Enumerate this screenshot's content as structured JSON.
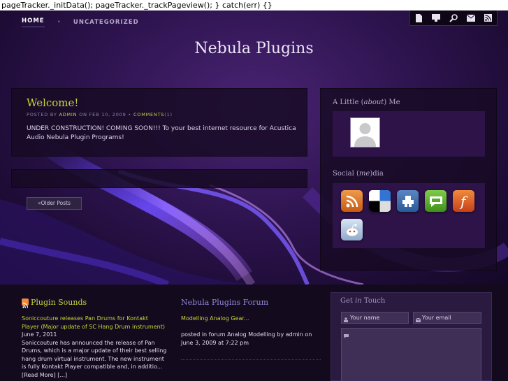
{
  "script_leak": "pageTracker._initData(); pageTracker._trackPageview(); } catch(err) {}",
  "nav": {
    "home": "HOME",
    "separator": "•",
    "uncategorized": "UNCATEGORIZED"
  },
  "toolbar_icons": [
    "document-icon",
    "monitor-icon",
    "search-icon",
    "mail-icon",
    "rss-icon"
  ],
  "site_title": "Nebula Plugins",
  "post": {
    "title": "Welcome!",
    "meta_prefix": "POSTED BY",
    "author": "ADMIN",
    "meta_on": "ON FEB 10, 2009 •",
    "comments_label": "COMMENTS",
    "comments_count": "(1)",
    "body": "UNDER CONSTRUCTION! COMING SOON!!! To your best internet resource for Acustica Audio Nebula Plugin Programs!"
  },
  "older_posts": "«Older Posts",
  "sidebar": {
    "about": {
      "a": "A Little (",
      "em": "about",
      "b": ") Me"
    },
    "social": {
      "a": "Social (",
      "em": "me",
      "b": ")dia"
    },
    "social_icons": [
      "rss-feed-icon",
      "delicious-icon",
      "stumbleupon-icon",
      "technorati-icon",
      "facebook-icon",
      "reddit-icon"
    ]
  },
  "footer": {
    "sounds_title": "Plugin Sounds",
    "sounds_link": "Soniccouture releases Pan Drums for Kontakt Player (Major update of SC Hang Drum instrument)",
    "sounds_date": " June 7, 2011",
    "sounds_body": "Soniccouture has announced the release of Pan Drums, which is a major update of their best selling hang drum virtual instrument. The new instrument is fully Kontakt Player compatible and, in additio... [Read More] [...]",
    "forum_title": "Nebula Plugins Forum",
    "forum_link": "Modelling Analog Gear...",
    "forum_body": "posted in forum Analog Modelling  by admin on June 3, 2009 at 7:22 pm",
    "touch": {
      "a": "Get ",
      "em": "in",
      "b": " Touch"
    },
    "name_placeholder": "Your name",
    "email_placeholder": "Your email"
  },
  "colors": {
    "accent": "#c8d43a",
    "background": "#1a0a2a",
    "panel": "#2d1348"
  }
}
